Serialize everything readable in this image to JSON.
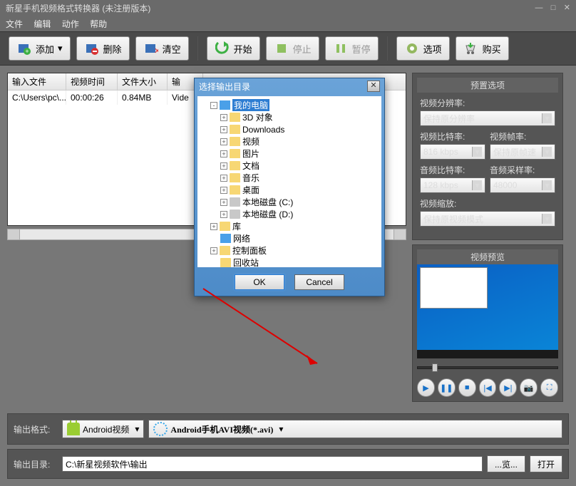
{
  "title": "新星手机视频格式转换器  (未注册版本)",
  "menu": {
    "file": "文件",
    "edit": "编辑",
    "action": "动作",
    "help": "帮助"
  },
  "toolbar": {
    "add": "添加",
    "del": "删除",
    "clear": "清空",
    "start": "开始",
    "stop": "停止",
    "pause": "暂停",
    "options": "选项",
    "buy": "购买"
  },
  "table": {
    "hdr": {
      "file": "输入文件",
      "time": "视频时间",
      "size": "文件大小",
      "type": "输"
    },
    "row": {
      "file": "C:\\Users\\pc\\...",
      "time": "00:00:26",
      "size": "0.84MB",
      "type": "Vide"
    }
  },
  "preset": {
    "title": "预置选项",
    "res": "视频分辨率:",
    "res_v": "保持原分辨率",
    "vbr": "视频比特率:",
    "vbr_v": "816 kbps",
    "vfr": "视频帧率:",
    "vfr_v": "保持原帧速",
    "abr": "音频比特率:",
    "abr_v": "128 kbps",
    "asr": "音频采样率:",
    "asr_v": "48000",
    "zoom": "视频缩放:",
    "zoom_v": "保持原视频模式"
  },
  "preview_title": "视频预览",
  "out": {
    "fmt_lbl": "输出格式:",
    "fmt1": "Android视频",
    "fmt2": "Android手机AVI视频(*.avi)",
    "dir_lbl": "输出目录:",
    "dir_v": "C:\\新星视频软件\\输出",
    "browse": "...览...",
    "open": "打开"
  },
  "dialog": {
    "title": "选择输出目录",
    "ok": "OK",
    "cancel": "Cancel",
    "nodes": [
      {
        "d": 1,
        "exp": "-",
        "ico": "ipc",
        "lbl": "我的电脑",
        "sel": true
      },
      {
        "d": 2,
        "exp": "+",
        "ico": "ifolder",
        "lbl": "3D 对象"
      },
      {
        "d": 2,
        "exp": "+",
        "ico": "ifolder",
        "lbl": "Downloads"
      },
      {
        "d": 2,
        "exp": "+",
        "ico": "ifolder",
        "lbl": "视频"
      },
      {
        "d": 2,
        "exp": "+",
        "ico": "ifolder",
        "lbl": "图片"
      },
      {
        "d": 2,
        "exp": "+",
        "ico": "ifolder",
        "lbl": "文档"
      },
      {
        "d": 2,
        "exp": "+",
        "ico": "ifolder",
        "lbl": "音乐"
      },
      {
        "d": 2,
        "exp": "+",
        "ico": "ifolder",
        "lbl": "桌面"
      },
      {
        "d": 2,
        "exp": "+",
        "ico": "idrive",
        "lbl": "本地磁盘 (C:)"
      },
      {
        "d": 2,
        "exp": "+",
        "ico": "idrive",
        "lbl": "本地磁盘 (D:)"
      },
      {
        "d": 1,
        "exp": "+",
        "ico": "ifolder",
        "lbl": "库"
      },
      {
        "d": 1,
        "exp": "",
        "ico": "ipc",
        "lbl": "网络"
      },
      {
        "d": 1,
        "exp": "+",
        "ico": "ifolder",
        "lbl": "控制面板"
      },
      {
        "d": 1,
        "exp": "",
        "ico": "ifolder",
        "lbl": "回收站"
      }
    ]
  }
}
